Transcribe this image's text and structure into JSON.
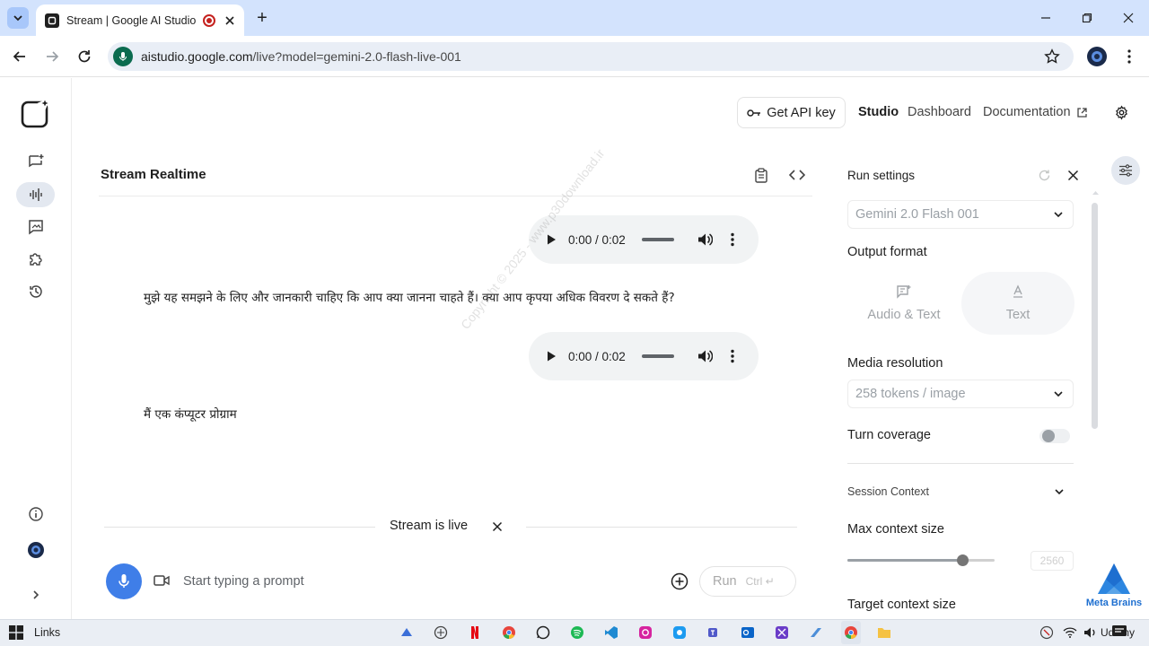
{
  "browser": {
    "tab_title": "Stream | Google AI Studio",
    "new_tab": "+",
    "url_host": "aistudio.google.com",
    "url_path": "/live?model=gemini-2.0-flash-live-001"
  },
  "nav": {
    "get_api_key": "Get API key",
    "studio": "Studio",
    "dashboard": "Dashboard",
    "documentation": "Documentation"
  },
  "main": {
    "title": "Stream Realtime",
    "audio_1": {
      "time": "0:00 / 0:02"
    },
    "message_1": "मुझे यह समझने के लिए और जानकारी चाहिए कि आप क्या जानना चाहते हैं। क्या आप कृपया अधिक विवरण दे सकते हैं?",
    "audio_2": {
      "time": "0:00 / 0:02"
    },
    "message_2": "मैं एक कंप्यूटर प्रोग्राम",
    "watermark": "Copyright © 2025 - www.p30download.ir",
    "stream_status": "Stream is live",
    "prompt_placeholder": "Start typing a prompt",
    "run_label": "Run",
    "run_hint": "Ctrl ↵"
  },
  "run_settings": {
    "title": "Run settings",
    "model": "Gemini 2.0 Flash 001",
    "output_format_label": "Output format",
    "format_audio_text": "Audio & Text",
    "format_text": "Text",
    "media_resolution_label": "Media resolution",
    "media_resolution_value": "258 tokens / image",
    "turn_coverage_label": "Turn coverage",
    "turn_coverage_enabled": false,
    "session_context_label": "Session Context",
    "max_context_label": "Max context size",
    "max_context_value": "2560",
    "target_context_label": "Target context size"
  },
  "brand": {
    "name": "Meta Brains"
  },
  "taskbar": {
    "links_label": "Links",
    "tray_text": "Udemy"
  },
  "colors": {
    "accent": "#3f7ee8",
    "chrome": "#d3e3fd",
    "omnibox": "#e9eef6"
  }
}
